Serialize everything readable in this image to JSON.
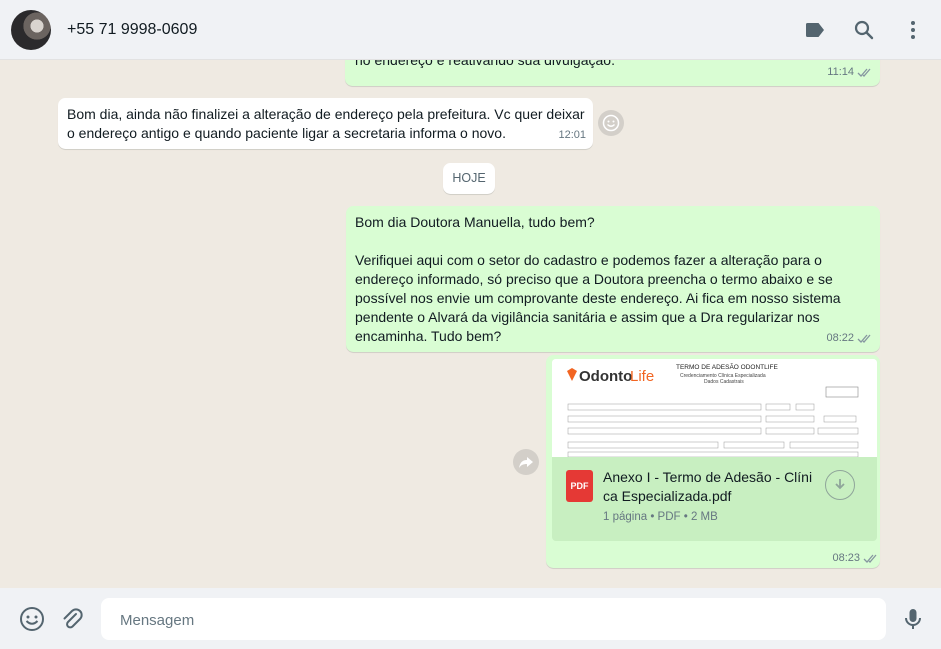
{
  "header": {
    "contact_name": "+55 71 9998-0609",
    "icons": [
      "label-icon",
      "search-icon",
      "menu-icon"
    ]
  },
  "messages": [
    {
      "direction": "outgoing",
      "text": "no endereço e reativando sua divulgação.",
      "time": "11:14",
      "status": "read"
    },
    {
      "direction": "incoming",
      "lines": [
        "Bom dia, ainda não finalizei a alteração de endereço pela prefeitura. Vc quer deixar",
        "o endereço antigo e quando paciente ligar a secretaria informa o novo."
      ],
      "time": "12:01"
    },
    {
      "direction": "outgoing",
      "greeting": "Bom dia Doutora Manuella, tudo bem?",
      "lines": [
        "Verifiquei aqui com o setor do cadastro e podemos fazer a alteração para o",
        "endereço informado, só preciso que a Doutora preencha o termo abaixo e se",
        "possível nos envie um comprovante deste endereço. Ai fica em nosso sistema",
        "pendente o  Alvará da vigilância sanitária e assim que a Dra regularizar nos",
        "encaminha. Tudo bem?"
      ],
      "time": "08:22",
      "status": "read"
    },
    {
      "direction": "outgoing",
      "type": "document",
      "thumbnail": {
        "logo": "OdontoLife",
        "title": "TERMO DE ADESÃO ODONTLIFE",
        "subtitle1": "Credenciamento Clínica Especializada",
        "subtitle2": "Dados Cadastrais"
      },
      "file_icon_label": "PDF",
      "file_name_line1": "Anexo I - Termo de Adesão - Clíni",
      "file_name_line2": "ca Especializada.pdf",
      "file_info": "1 página • PDF • 2 MB",
      "time": "08:23",
      "status": "read"
    }
  ],
  "day_divider": "HOJE",
  "composer": {
    "placeholder": "Mensagem"
  },
  "colors": {
    "outgoing_bubble": "#d9fdd3",
    "incoming_bubble": "#ffffff",
    "chat_background": "#efeae2",
    "read_ticks": "#53bdeb",
    "pdf_red": "#e53935"
  }
}
